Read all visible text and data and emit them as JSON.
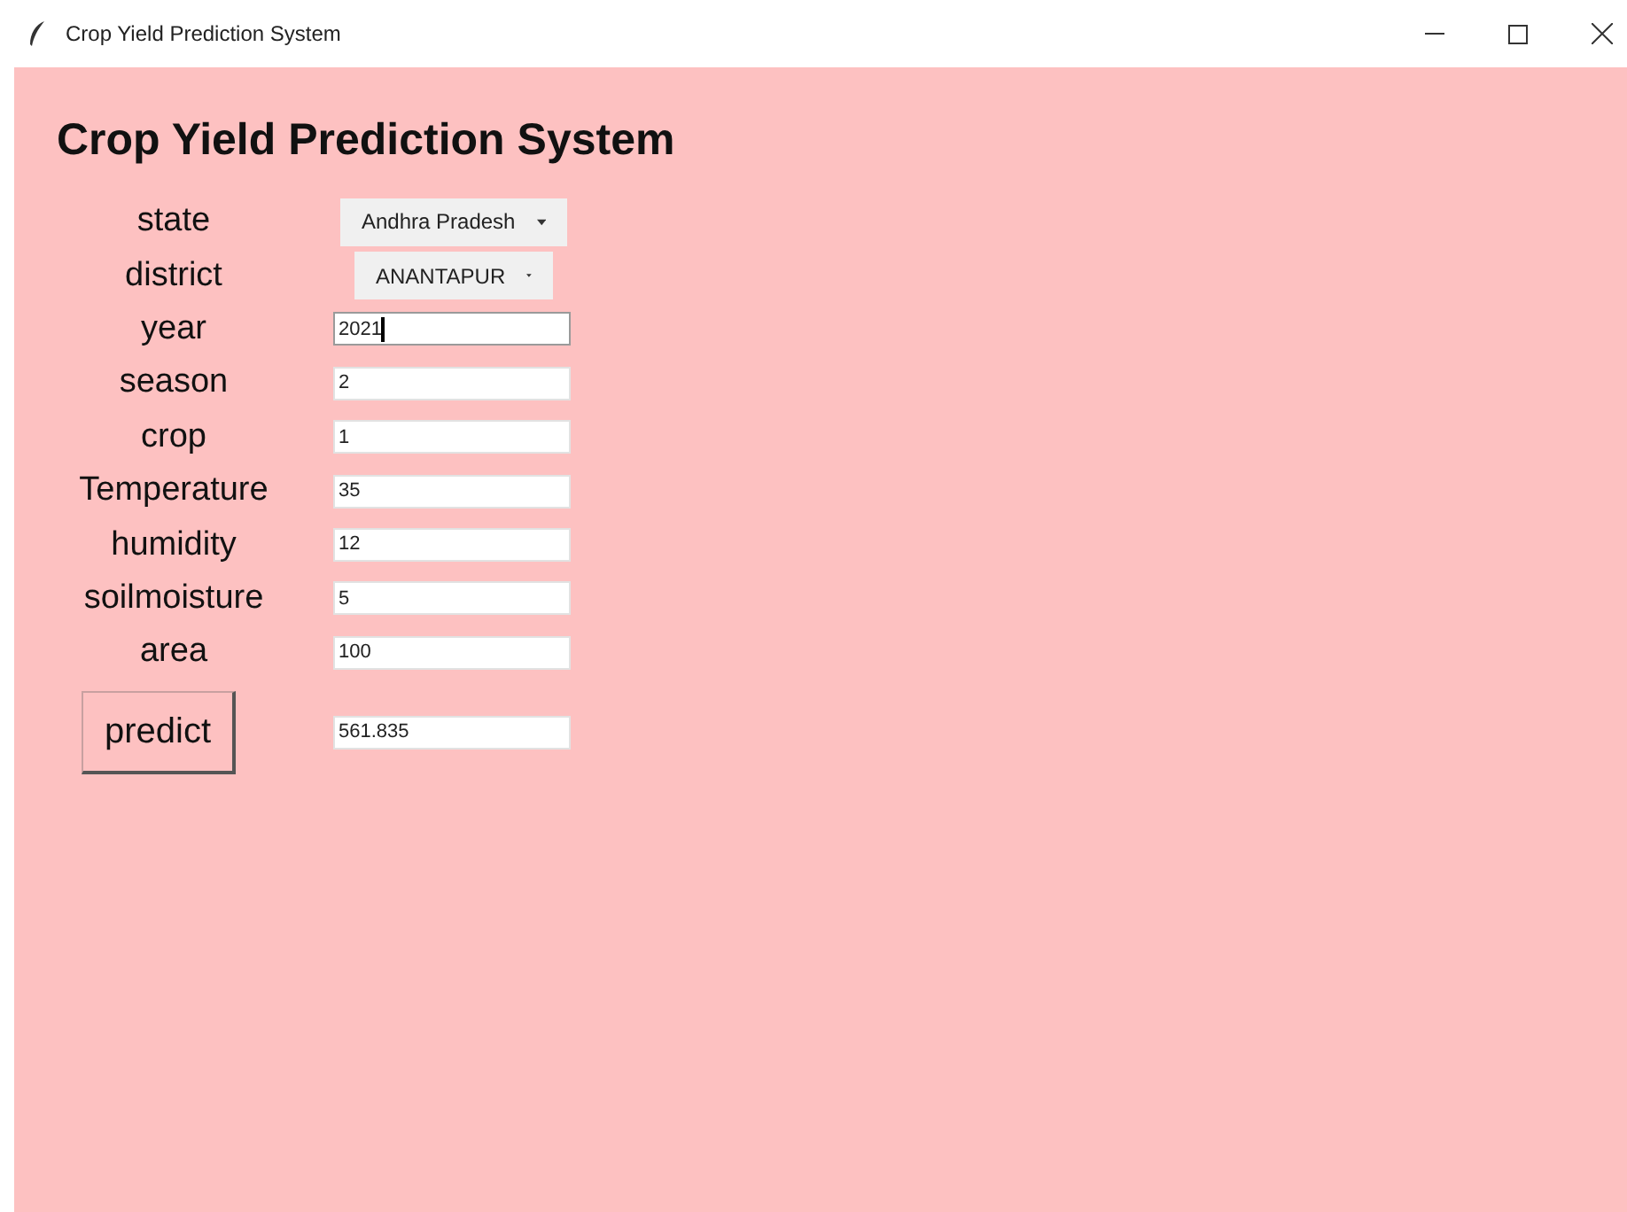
{
  "window": {
    "title": "Crop Yield Prediction System"
  },
  "heading": "Crop Yield Prediction System",
  "fields": [
    {
      "label": "state",
      "kind": "dropdown",
      "value": "Andhra Pradesh"
    },
    {
      "label": "district",
      "kind": "dropdown",
      "value": "ANANTAPUR"
    },
    {
      "label": "year",
      "kind": "entry",
      "value": "2021",
      "focused": true
    },
    {
      "label": "season",
      "kind": "entry",
      "value": "2",
      "focused": false
    },
    {
      "label": "crop",
      "kind": "entry",
      "value": "1",
      "focused": false
    },
    {
      "label": "Temperature",
      "kind": "entry",
      "value": "35",
      "focused": false
    },
    {
      "label": "humidity",
      "kind": "entry",
      "value": "12",
      "focused": false
    },
    {
      "label": "soilmoisture",
      "kind": "entry",
      "value": "5",
      "focused": false
    },
    {
      "label": "area",
      "kind": "entry",
      "value": "100",
      "focused": false
    }
  ],
  "predict": {
    "button": "predict",
    "result": "561.835"
  }
}
